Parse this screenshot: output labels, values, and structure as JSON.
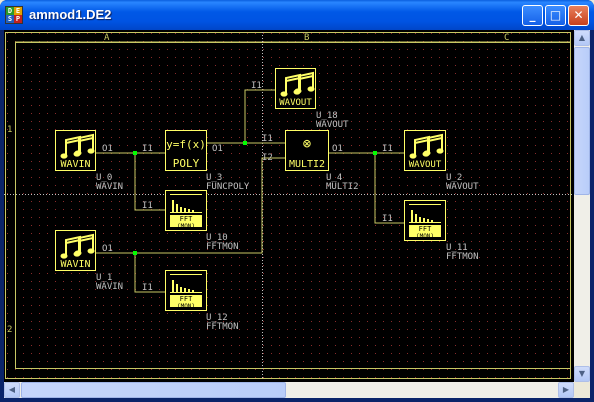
{
  "window": {
    "title": "ammod1.DE2",
    "icon_letters": [
      "D",
      "E",
      "S",
      "P"
    ],
    "minimize_glyph": "_",
    "maximize_glyph": "□",
    "close_glyph": "✕"
  },
  "colors": {
    "canvas_bg": "#000000",
    "grid_dot": "#8a2a2a",
    "frame": "#c8c864",
    "text": "#c0c0c0",
    "block_border": "#ffff66",
    "wire_dot": "#00ff00"
  },
  "sheet": {
    "columns": [
      "A",
      "B",
      "C"
    ],
    "rows": [
      "1",
      "2"
    ]
  },
  "blocks": [
    {
      "id": "U_0",
      "type": "WAVIN",
      "icon": "music-note-icon",
      "label": "WAVIN",
      "name": "U_0",
      "caption": "WAVIN",
      "ports": [
        "O1"
      ]
    },
    {
      "id": "U_1",
      "type": "WAVIN",
      "icon": "music-note-icon",
      "label": "WAVIN",
      "name": "U_1",
      "caption": "WAVIN",
      "ports": [
        "O1"
      ]
    },
    {
      "id": "U_3",
      "type": "FUNCPOLY",
      "icon": "function-icon",
      "icon_text": "y=f(x)",
      "label": "POLY",
      "name": "U_3",
      "caption": "FUNCPOLY",
      "ports": [
        "I1",
        "O1"
      ]
    },
    {
      "id": "U_10",
      "type": "FFTMON",
      "icon": "spectrum-icon",
      "label": "FFT",
      "sublabel": "(MON)",
      "name": "U_10",
      "caption": "FFTMON",
      "ports": [
        "I1"
      ]
    },
    {
      "id": "U_12",
      "type": "FFTMON",
      "icon": "spectrum-icon",
      "label": "FFT",
      "sublabel": "(MON)",
      "name": "U_12",
      "caption": "FFTMON",
      "ports": [
        "I1"
      ]
    },
    {
      "id": "U_18",
      "type": "WAVOUT",
      "icon": "music-note-icon",
      "label": "WAVOUT",
      "name": "U_18",
      "caption": "WAVOUT",
      "ports": [
        "I1"
      ]
    },
    {
      "id": "U_4",
      "type": "MULTI2",
      "icon": "multiply-icon",
      "icon_text": "⊗",
      "label": "MULTI2",
      "name": "U_4",
      "caption": "MULTI2",
      "ports": [
        "I1",
        "I2",
        "O1"
      ]
    },
    {
      "id": "U_2",
      "type": "WAVOUT",
      "icon": "music-note-icon",
      "label": "WAVOUT",
      "name": "U_2",
      "caption": "WAVOUT",
      "ports": [
        "I1"
      ]
    },
    {
      "id": "U_11",
      "type": "FFTMON",
      "icon": "spectrum-icon",
      "label": "FFT",
      "sublabel": "(MON)",
      "name": "U_11",
      "caption": "FFTMON",
      "ports": [
        "I1"
      ]
    }
  ]
}
